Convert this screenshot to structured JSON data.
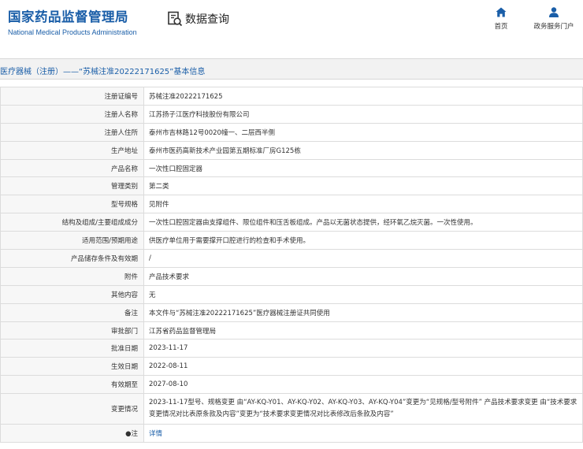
{
  "header": {
    "logo_cn": "国家药品监督管理局",
    "logo_en": "National Medical Products Administration",
    "query_title": "数据查询",
    "query_icon": "search-document-icon",
    "nav": [
      {
        "label": "首页",
        "icon": "home-icon"
      },
      {
        "label": "政务服务门户",
        "icon": "user-icon"
      }
    ],
    "brand_color": "#1a5ea8"
  },
  "breadcrumb": "医疗器械（注册）——“苏械注准20222171625”基本信息",
  "table": {
    "rows": [
      {
        "label": "注册证编号",
        "value": "苏械注准20222171625"
      },
      {
        "label": "注册人名称",
        "value": "江苏扬子江医疗科技股份有限公司"
      },
      {
        "label": "注册人住所",
        "value": "泰州市吉林路12号0020幢一、二层西半侧"
      },
      {
        "label": "生产地址",
        "value": "泰州市医药高新技术产业园第五期标准厂房G125栋"
      },
      {
        "label": "产品名称",
        "value": "一次性口腔固定器"
      },
      {
        "label": "管理类别",
        "value": "第二类"
      },
      {
        "label": "型号规格",
        "value": "见附件"
      },
      {
        "label": "结构及组成/主要组成成分",
        "value": "一次性口腔固定器由支撑组件、限位组件和压舌板组成。产品以无菌状态提供，经环氧乙烷灭菌。一次性使用。"
      },
      {
        "label": "适用范围/预期用途",
        "value": "供医疗单位用于需要撑开口腔进行的检查和手术使用。"
      },
      {
        "label": "产品储存条件及有效期",
        "value": "/"
      },
      {
        "label": "附件",
        "value": "产品技术要求"
      },
      {
        "label": "其他内容",
        "value": "无"
      },
      {
        "label": "备注",
        "value": "本文件与“苏械注准20222171625”医疗器械注册证共同使用"
      },
      {
        "label": "审批部门",
        "value": "江苏省药品监督管理局"
      },
      {
        "label": "批准日期",
        "value": "2023-11-17"
      },
      {
        "label": "生效日期",
        "value": "2022-08-11"
      },
      {
        "label": "有效期至",
        "value": "2027-08-10"
      },
      {
        "label": "变更情况",
        "value": "2023-11-17型号、规格变更 由“AY-KQ-Y01、AY-KQ-Y02、AY-KQ-Y03、AY-KQ-Y04”变更为“见规格/型号附件” 产品技术要求变更 由“技术要求变更情况对比表原条款及内容”变更为“技术要求变更情况对比表修改后条款及内容”"
      }
    ],
    "note_label": "注",
    "note_icon": "bullet-dot-icon",
    "note_link": "详情"
  }
}
